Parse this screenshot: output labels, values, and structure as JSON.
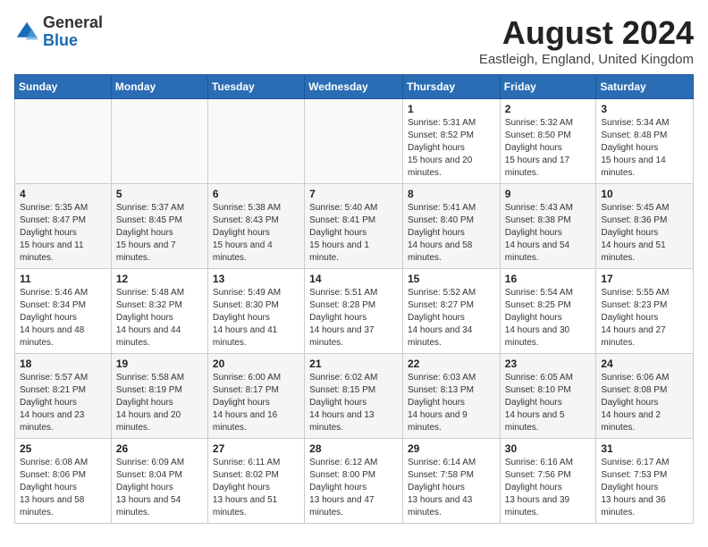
{
  "logo": {
    "general": "General",
    "blue": "Blue"
  },
  "title": {
    "month_year": "August 2024",
    "location": "Eastleigh, England, United Kingdom"
  },
  "days_of_week": [
    "Sunday",
    "Monday",
    "Tuesday",
    "Wednesday",
    "Thursday",
    "Friday",
    "Saturday"
  ],
  "weeks": [
    [
      {
        "num": "",
        "info": ""
      },
      {
        "num": "",
        "info": ""
      },
      {
        "num": "",
        "info": ""
      },
      {
        "num": "",
        "info": ""
      },
      {
        "num": "1",
        "sunrise": "5:31 AM",
        "sunset": "8:52 PM",
        "daylight": "15 hours and 20 minutes."
      },
      {
        "num": "2",
        "sunrise": "5:32 AM",
        "sunset": "8:50 PM",
        "daylight": "15 hours and 17 minutes."
      },
      {
        "num": "3",
        "sunrise": "5:34 AM",
        "sunset": "8:48 PM",
        "daylight": "15 hours and 14 minutes."
      }
    ],
    [
      {
        "num": "4",
        "sunrise": "5:35 AM",
        "sunset": "8:47 PM",
        "daylight": "15 hours and 11 minutes."
      },
      {
        "num": "5",
        "sunrise": "5:37 AM",
        "sunset": "8:45 PM",
        "daylight": "15 hours and 7 minutes."
      },
      {
        "num": "6",
        "sunrise": "5:38 AM",
        "sunset": "8:43 PM",
        "daylight": "15 hours and 4 minutes."
      },
      {
        "num": "7",
        "sunrise": "5:40 AM",
        "sunset": "8:41 PM",
        "daylight": "15 hours and 1 minute."
      },
      {
        "num": "8",
        "sunrise": "5:41 AM",
        "sunset": "8:40 PM",
        "daylight": "14 hours and 58 minutes."
      },
      {
        "num": "9",
        "sunrise": "5:43 AM",
        "sunset": "8:38 PM",
        "daylight": "14 hours and 54 minutes."
      },
      {
        "num": "10",
        "sunrise": "5:45 AM",
        "sunset": "8:36 PM",
        "daylight": "14 hours and 51 minutes."
      }
    ],
    [
      {
        "num": "11",
        "sunrise": "5:46 AM",
        "sunset": "8:34 PM",
        "daylight": "14 hours and 48 minutes."
      },
      {
        "num": "12",
        "sunrise": "5:48 AM",
        "sunset": "8:32 PM",
        "daylight": "14 hours and 44 minutes."
      },
      {
        "num": "13",
        "sunrise": "5:49 AM",
        "sunset": "8:30 PM",
        "daylight": "14 hours and 41 minutes."
      },
      {
        "num": "14",
        "sunrise": "5:51 AM",
        "sunset": "8:28 PM",
        "daylight": "14 hours and 37 minutes."
      },
      {
        "num": "15",
        "sunrise": "5:52 AM",
        "sunset": "8:27 PM",
        "daylight": "14 hours and 34 minutes."
      },
      {
        "num": "16",
        "sunrise": "5:54 AM",
        "sunset": "8:25 PM",
        "daylight": "14 hours and 30 minutes."
      },
      {
        "num": "17",
        "sunrise": "5:55 AM",
        "sunset": "8:23 PM",
        "daylight": "14 hours and 27 minutes."
      }
    ],
    [
      {
        "num": "18",
        "sunrise": "5:57 AM",
        "sunset": "8:21 PM",
        "daylight": "14 hours and 23 minutes."
      },
      {
        "num": "19",
        "sunrise": "5:58 AM",
        "sunset": "8:19 PM",
        "daylight": "14 hours and 20 minutes."
      },
      {
        "num": "20",
        "sunrise": "6:00 AM",
        "sunset": "8:17 PM",
        "daylight": "14 hours and 16 minutes."
      },
      {
        "num": "21",
        "sunrise": "6:02 AM",
        "sunset": "8:15 PM",
        "daylight": "14 hours and 13 minutes."
      },
      {
        "num": "22",
        "sunrise": "6:03 AM",
        "sunset": "8:13 PM",
        "daylight": "14 hours and 9 minutes."
      },
      {
        "num": "23",
        "sunrise": "6:05 AM",
        "sunset": "8:10 PM",
        "daylight": "14 hours and 5 minutes."
      },
      {
        "num": "24",
        "sunrise": "6:06 AM",
        "sunset": "8:08 PM",
        "daylight": "14 hours and 2 minutes."
      }
    ],
    [
      {
        "num": "25",
        "sunrise": "6:08 AM",
        "sunset": "8:06 PM",
        "daylight": "13 hours and 58 minutes."
      },
      {
        "num": "26",
        "sunrise": "6:09 AM",
        "sunset": "8:04 PM",
        "daylight": "13 hours and 54 minutes."
      },
      {
        "num": "27",
        "sunrise": "6:11 AM",
        "sunset": "8:02 PM",
        "daylight": "13 hours and 51 minutes."
      },
      {
        "num": "28",
        "sunrise": "6:12 AM",
        "sunset": "8:00 PM",
        "daylight": "13 hours and 47 minutes."
      },
      {
        "num": "29",
        "sunrise": "6:14 AM",
        "sunset": "7:58 PM",
        "daylight": "13 hours and 43 minutes."
      },
      {
        "num": "30",
        "sunrise": "6:16 AM",
        "sunset": "7:56 PM",
        "daylight": "13 hours and 39 minutes."
      },
      {
        "num": "31",
        "sunrise": "6:17 AM",
        "sunset": "7:53 PM",
        "daylight": "13 hours and 36 minutes."
      }
    ]
  ],
  "labels": {
    "sunrise": "Sunrise:",
    "sunset": "Sunset:",
    "daylight": "Daylight hours"
  }
}
